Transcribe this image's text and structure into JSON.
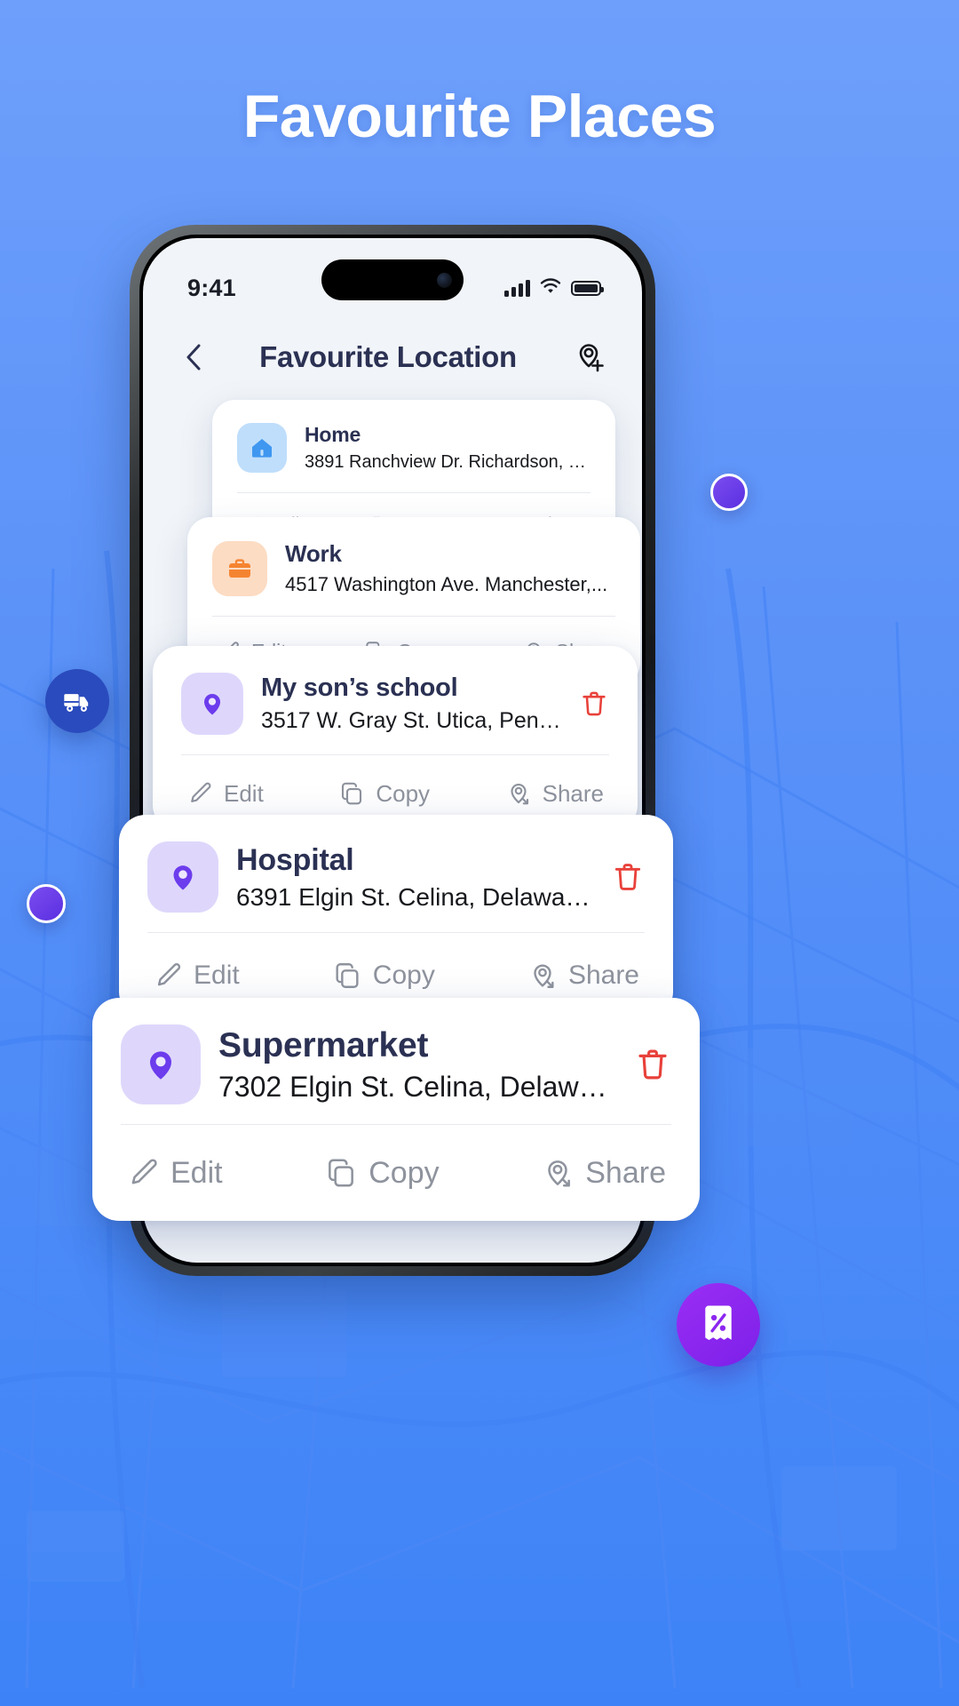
{
  "page": {
    "title": "Favourite Places",
    "background_color": "#5b92f8"
  },
  "phone": {
    "status_bar": {
      "time": "9:41",
      "signal_icon": "cellular-signal-icon",
      "wifi_icon": "wifi-icon",
      "battery_icon": "battery-icon"
    },
    "header": {
      "back_icon": "chevron-left-icon",
      "title": "Favourite Location",
      "add_location_icon": "add-location-pin-icon"
    }
  },
  "actions": {
    "edit_label": "Edit",
    "copy_label": "Copy",
    "share_label": "Share",
    "edit_icon": "pencil-icon",
    "copy_icon": "copy-icon",
    "share_icon": "share-location-icon",
    "delete_icon": "trash-icon"
  },
  "locations": [
    {
      "name": "Home",
      "address": "3891 Ranchview Dr. Richardson, Cal...",
      "icon": "house-icon",
      "icon_bg": "#bfdefb",
      "icon_color": "#3f97f0",
      "has_delete": false
    },
    {
      "name": "Work",
      "address": "4517 Washington Ave. Manchester,...",
      "icon": "briefcase-icon",
      "icon_bg": "#fcdcc3",
      "icon_color": "#f58431",
      "has_delete": false
    },
    {
      "name": "My son’s school",
      "address": "3517 W. Gray St. Utica, Pennsylvani...",
      "icon": "map-pin-icon",
      "icon_bg": "#ded7fb",
      "icon_color": "#6c3ced",
      "has_delete": true
    },
    {
      "name": "Hospital",
      "address": "6391 Elgin St. Celina, Delaware 102...",
      "icon": "map-pin-icon",
      "icon_bg": "#ded7fb",
      "icon_color": "#6c3ced",
      "has_delete": true
    },
    {
      "name": "Supermarket",
      "address": "7302 Elgin St. Celina, Delaware 102...",
      "icon": "map-pin-icon",
      "icon_bg": "#ded7fb",
      "icon_color": "#6c3ced",
      "has_delete": true
    }
  ],
  "floating": {
    "truck_icon": "delivery-truck-icon",
    "truck_bg": "#2a4bbd",
    "promo_icon": "discount-receipt-icon",
    "promo_bg": "#8c27f0",
    "dot_color": "#6a3bea"
  }
}
